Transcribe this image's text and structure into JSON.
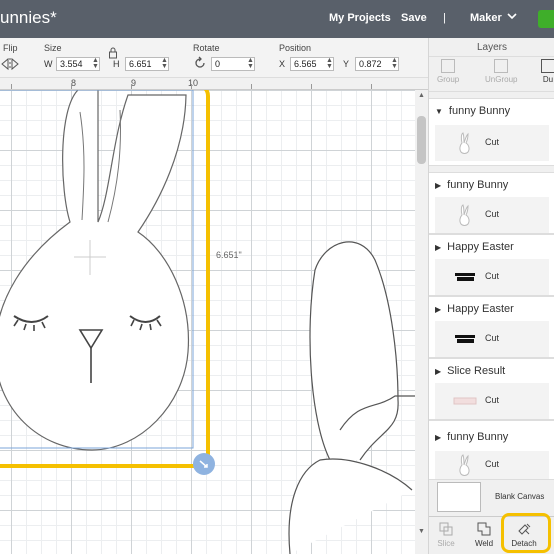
{
  "topbar": {
    "title": "unnies*",
    "my_projects": "My Projects",
    "save": "Save",
    "divider": "|",
    "machine": "Maker",
    "chevron_icon": "chevron-down-icon",
    "accent": "#3fae2a"
  },
  "toolbar": {
    "flip_label": "Flip",
    "size_label": "Size",
    "w_prefix": "W",
    "w_value": "3.554",
    "h_prefix": "H",
    "h_value": "6.651",
    "rotate_label": "Rotate",
    "rotate_value": "0",
    "position_label": "Position",
    "x_prefix": "X",
    "x_value": "6.565",
    "y_prefix": "Y",
    "y_value": "0.872"
  },
  "ruler": {
    "numbers": [
      "8",
      "9",
      "10"
    ]
  },
  "canvas": {
    "dimension_label": "6.651\"",
    "selection_color": "#f5c000"
  },
  "layers": {
    "title": "Layers",
    "tools": [
      "Group",
      "UnGroup",
      "Du"
    ],
    "groups": [
      {
        "name": "funny Bunny",
        "sub": "Cut",
        "thumb": "bunny"
      },
      {
        "name": "funny Bunny",
        "sub": "Cut",
        "thumb": "bunny"
      },
      {
        "name": "Happy Easter",
        "sub": "Cut",
        "thumb": "text"
      },
      {
        "name": "Happy Easter",
        "sub": "Cut",
        "thumb": "text"
      },
      {
        "name": "Slice Result",
        "sub": "Cut",
        "thumb": "slice"
      },
      {
        "name": "funny Bunny",
        "sub": "Cut",
        "thumb": "bunny"
      }
    ],
    "blank_canvas": "Blank Canvas",
    "bottom_tools": [
      "Slice",
      "Weld",
      "Detach"
    ]
  }
}
